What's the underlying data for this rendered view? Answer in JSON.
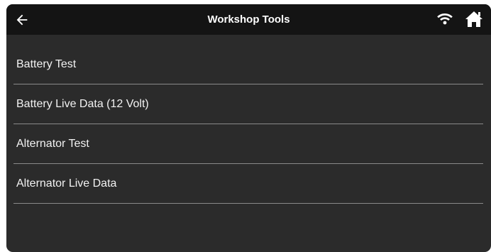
{
  "header": {
    "title": "Workshop Tools",
    "back_icon": "arrow-left-icon",
    "wifi_icon": "wifi-icon",
    "home_icon": "home-icon"
  },
  "menu": {
    "items": [
      {
        "label": "Battery Test"
      },
      {
        "label": "Battery Live Data (12 Volt)"
      },
      {
        "label": "Alternator Test"
      },
      {
        "label": "Alternator Live Data"
      }
    ]
  },
  "colors": {
    "background": "#2b2b2b",
    "header": "#141414",
    "text": "#ffffff",
    "divider": "#8a8a8a"
  }
}
